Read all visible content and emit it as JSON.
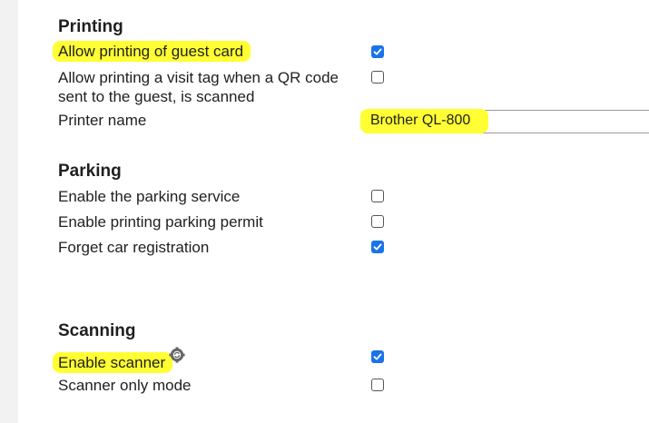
{
  "sections": {
    "printing": {
      "title": "Printing",
      "rows": [
        {
          "label": "Allow printing of guest card",
          "checked": true,
          "highlighted": true
        },
        {
          "label_line1": "Allow printing a visit tag when a QR code",
          "label_line2": "sent to the guest, is scanned",
          "checked": false
        },
        {
          "label": "Printer name",
          "input_value": "Brother QL-800"
        }
      ]
    },
    "parking": {
      "title": "Parking",
      "rows": [
        {
          "label": "Enable the parking service",
          "checked": false
        },
        {
          "label": "Enable printing parking permit",
          "checked": false
        },
        {
          "label": "Forget car registration",
          "checked": true
        }
      ]
    },
    "scanning": {
      "title": "Scanning",
      "rows": [
        {
          "label": "Enable scanner",
          "checked": true,
          "highlighted": true,
          "icon": "sync-gear-icon"
        },
        {
          "label": "Scanner only mode",
          "checked": false
        }
      ]
    }
  },
  "colors": {
    "highlight": "#ffff33",
    "checkbox_checked": "#1a73e8",
    "text": "#1f1f1f",
    "gutter": "#f2f2f2"
  }
}
